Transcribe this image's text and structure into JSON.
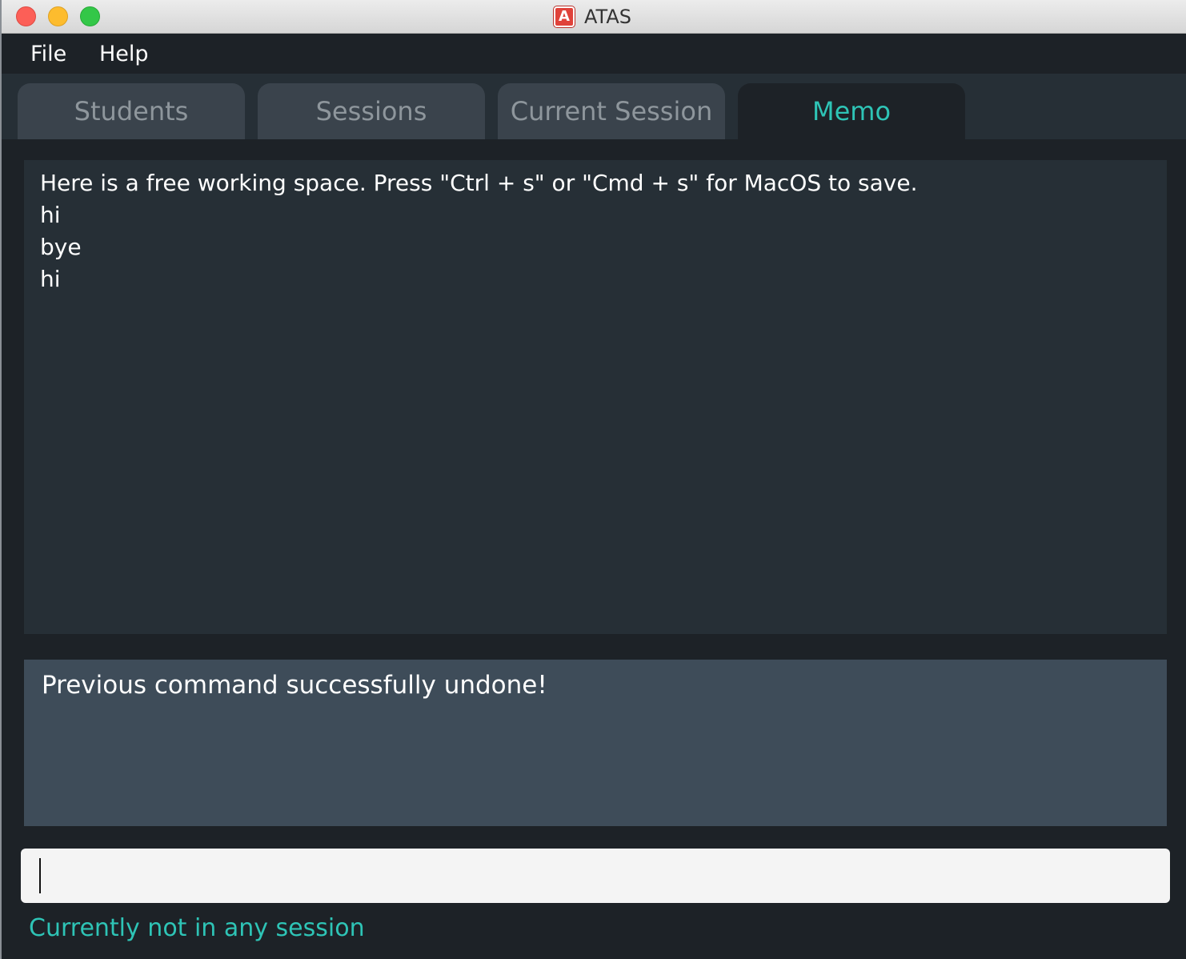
{
  "window": {
    "title": "ATAS",
    "app_icon_letter": "A"
  },
  "menubar": {
    "items": [
      {
        "label": "File"
      },
      {
        "label": "Help"
      }
    ]
  },
  "tabs": [
    {
      "label": "Students",
      "active": false
    },
    {
      "label": "Sessions",
      "active": false
    },
    {
      "label": "Current Session",
      "active": false
    },
    {
      "label": "Memo",
      "active": true
    }
  ],
  "memo": {
    "content": "Here is a free working space. Press \"Ctrl + s\" or \"Cmd + s\" for MacOS to save.\nhi\nbye\nhi"
  },
  "result": {
    "message": "Previous command successfully undone!"
  },
  "command": {
    "value": ""
  },
  "status": {
    "session_text": "Currently not in any session"
  },
  "colors": {
    "accent": "#2ec4b6",
    "background": "#1d2227",
    "panel": "#262f36",
    "result_panel": "#3e4c59"
  }
}
